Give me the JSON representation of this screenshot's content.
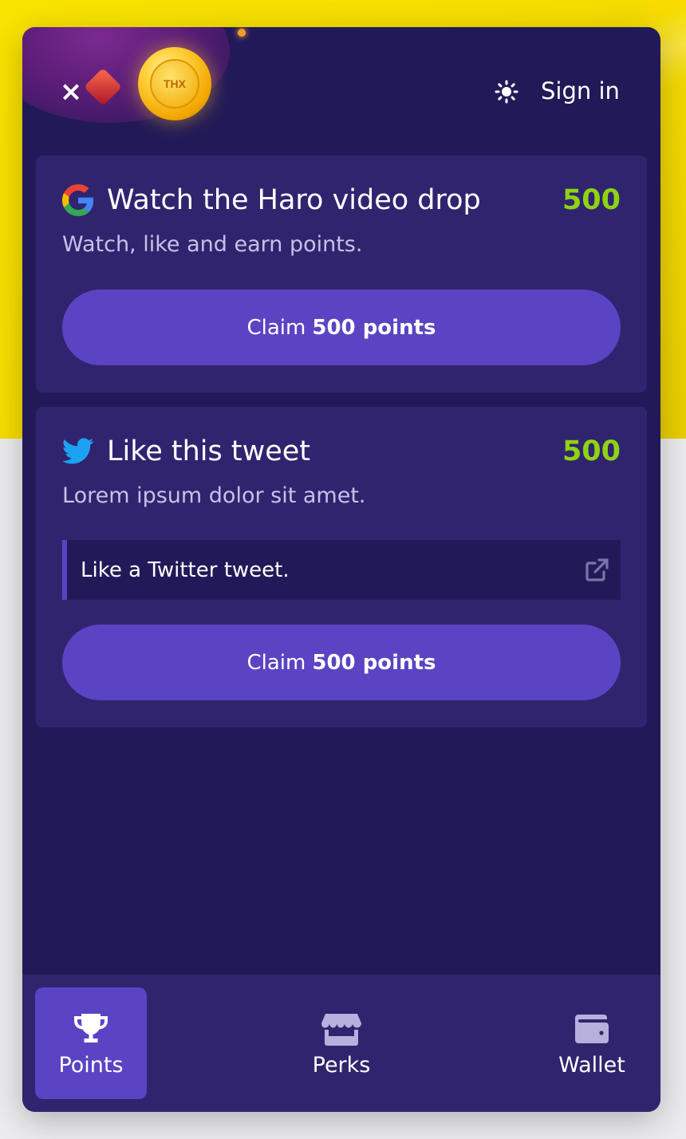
{
  "header": {
    "sign_in_label": "Sign in",
    "coin_text": "THX",
    "close_icon": "close-icon",
    "theme_icon": "sun-icon"
  },
  "quests": [
    {
      "icon": "google-icon",
      "title": "Watch the Haro video drop",
      "points": "500",
      "description": "Watch, like and earn points.",
      "claim_prefix": "Claim",
      "claim_amount": "500 points"
    },
    {
      "icon": "twitter-icon",
      "title": "Like this tweet",
      "points": "500",
      "description": "Lorem ipsum dolor sit amet.",
      "task_text": "Like a Twitter tweet.",
      "task_icon": "external-link-icon",
      "claim_prefix": "Claim",
      "claim_amount": "500 points"
    }
  ],
  "nav": {
    "items": [
      {
        "label": "Points",
        "icon": "trophy-icon",
        "active": true
      },
      {
        "label": "Perks",
        "icon": "store-icon",
        "active": false
      },
      {
        "label": "Wallet",
        "icon": "wallet-icon",
        "active": false
      }
    ]
  },
  "colors": {
    "page_yellow": "#f9e300",
    "panel_bg": "#221a58",
    "card_bg": "#30246f",
    "accent": "#5a44c3",
    "points_green": "#8fd312"
  }
}
